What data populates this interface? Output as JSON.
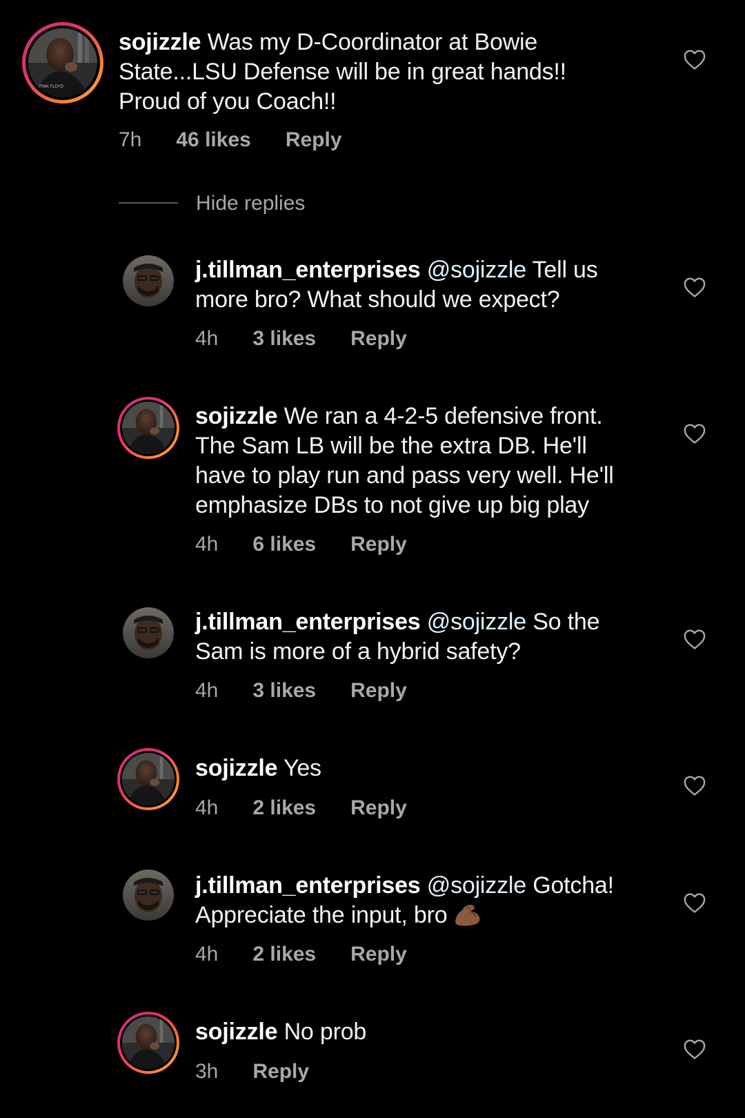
{
  "thread": {
    "hide_replies_label": "Hide replies",
    "comments": [
      {
        "username": "sojizzle",
        "mention": "",
        "text_line1": "Was my D-Coordinator at Bowie",
        "text_line2": "State...LSU Defense will be in great hands!!",
        "text_line3": "Proud of you Coach!!",
        "time": "7h",
        "likes": "46 likes",
        "reply": "Reply"
      },
      {
        "username": "j.tillman_enterprises",
        "mention": "@sojizzle",
        "text_line1": "Tell us",
        "text_line2": "more bro? What should we expect?",
        "time": "4h",
        "likes": "3 likes",
        "reply": "Reply"
      },
      {
        "username": "sojizzle",
        "mention": "",
        "text_line1": "We ran a 4-2-5 defensive front.",
        "text_line2": "The Sam LB will be the extra DB. He'll",
        "text_line3": "have to play run and pass very well. He'll",
        "text_line4": "emphasize DBs to not give up big play",
        "time": "4h",
        "likes": "6 likes",
        "reply": "Reply"
      },
      {
        "username": "j.tillman_enterprises",
        "mention": "@sojizzle",
        "text_line1": "So the",
        "text_line2": "Sam is more of a hybrid safety?",
        "time": "4h",
        "likes": "3 likes",
        "reply": "Reply"
      },
      {
        "username": "sojizzle",
        "mention": "",
        "text_line1": "Yes",
        "time": "4h",
        "likes": "2 likes",
        "reply": "Reply"
      },
      {
        "username": "j.tillman_enterprises",
        "mention": "@sojizzle",
        "text_line1": "Gotcha!",
        "text_line2": "Appreciate the input, bro",
        "emoji": "flexed-biceps-emoji",
        "time": "4h",
        "likes": "2 likes",
        "reply": "Reply"
      },
      {
        "username": "sojizzle",
        "mention": "",
        "text_line1": "No prob",
        "time": "3h",
        "reply": "Reply"
      }
    ]
  },
  "colors": {
    "background": "#000000",
    "text": "#f2f2f2",
    "meta": "#a8a8a8",
    "story_ring_start": "#c13584",
    "story_ring_end": "#fcaf45"
  },
  "icons": {
    "like": "heart-outline-icon"
  }
}
